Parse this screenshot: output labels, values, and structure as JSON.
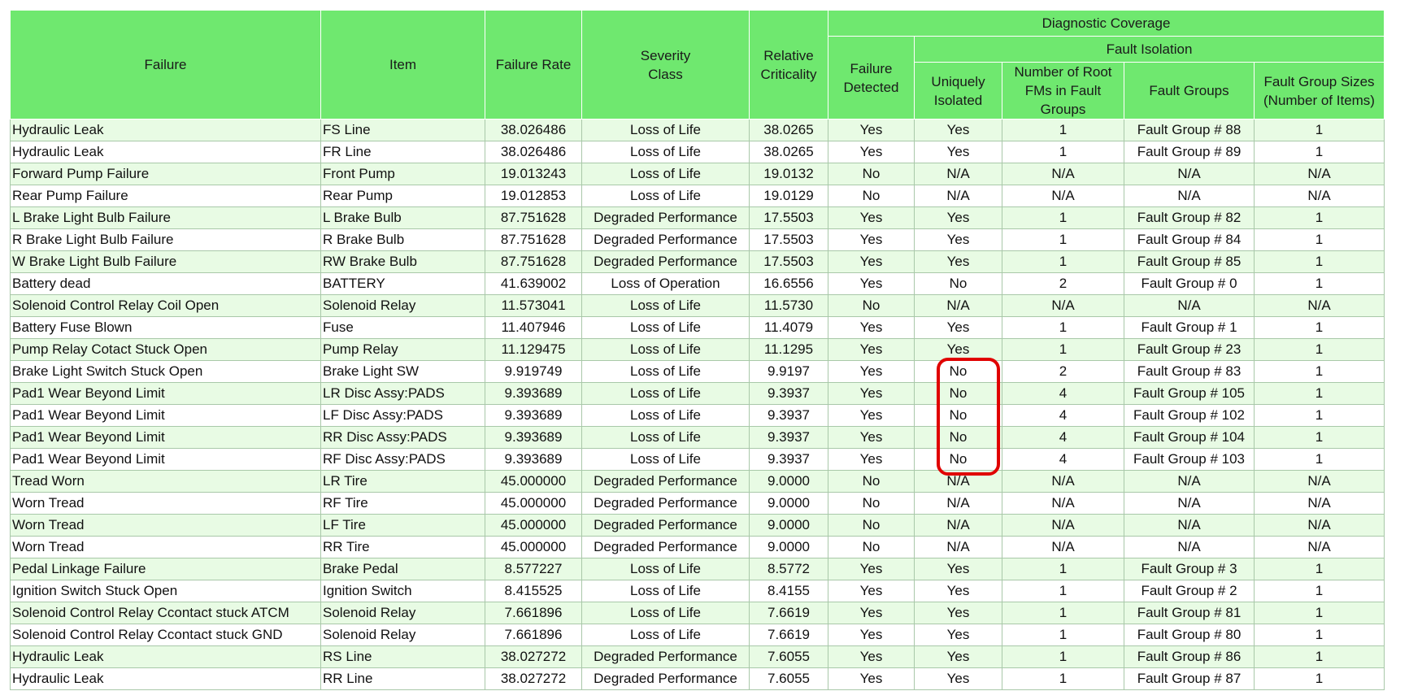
{
  "headers": {
    "failure": "Failure",
    "item": "Item",
    "failure_rate": "Failure Rate",
    "severity_class": "Severity Class",
    "relative_criticality": "Relative Criticality",
    "diagnostic_coverage": "Diagnostic Coverage",
    "failure_detected": "Failure Detected",
    "fault_isolation": "Fault Isolation",
    "uniquely_isolated": "Uniquely Isolated",
    "num_root_fms": "Number of Root FMs in Fault Groups",
    "fault_groups": "Fault Groups",
    "fault_group_sizes": "Fault Group Sizes (Number of Items)"
  },
  "highlight_color": "#e00000",
  "header_color": "#6fe86f",
  "stripe_color": "#e8fbe4",
  "rows": [
    [
      "Hydraulic Leak",
      "FS Line",
      "38.026486",
      "Loss of Life",
      "38.0265",
      "Yes",
      "Yes",
      "1",
      "Fault Group # 88",
      "1"
    ],
    [
      "Hydraulic Leak",
      "FR Line",
      "38.026486",
      "Loss of Life",
      "38.0265",
      "Yes",
      "Yes",
      "1",
      "Fault Group # 89",
      "1"
    ],
    [
      "Forward Pump Failure",
      "Front Pump",
      "19.013243",
      "Loss of Life",
      "19.0132",
      "No",
      "N/A",
      "N/A",
      "N/A",
      "N/A"
    ],
    [
      "Rear Pump Failure",
      "Rear Pump",
      "19.012853",
      "Loss of Life",
      "19.0129",
      "No",
      "N/A",
      "N/A",
      "N/A",
      "N/A"
    ],
    [
      "L Brake Light Bulb Failure",
      "L Brake Bulb",
      "87.751628",
      "Degraded Performance",
      "17.5503",
      "Yes",
      "Yes",
      "1",
      "Fault Group # 82",
      "1"
    ],
    [
      "R Brake Light Bulb Failure",
      "R Brake Bulb",
      "87.751628",
      "Degraded Performance",
      "17.5503",
      "Yes",
      "Yes",
      "1",
      "Fault Group # 84",
      "1"
    ],
    [
      "W Brake Light Bulb Failure",
      "RW Brake Bulb",
      "87.751628",
      "Degraded Performance",
      "17.5503",
      "Yes",
      "Yes",
      "1",
      "Fault Group # 85",
      "1"
    ],
    [
      "Battery dead",
      "BATTERY",
      "41.639002",
      "Loss of Operation",
      "16.6556",
      "Yes",
      "No",
      "2",
      "Fault Group # 0",
      "1"
    ],
    [
      "Solenoid Control Relay Coil Open",
      "Solenoid Relay",
      "11.573041",
      "Loss of Life",
      "11.5730",
      "No",
      "N/A",
      "N/A",
      "N/A",
      "N/A"
    ],
    [
      "Battery Fuse Blown",
      "Fuse",
      "11.407946",
      "Loss of Life",
      "11.4079",
      "Yes",
      "Yes",
      "1",
      "Fault Group # 1",
      "1"
    ],
    [
      "Pump Relay Cotact Stuck Open",
      "Pump Relay",
      "11.129475",
      "Loss of Life",
      "11.1295",
      "Yes",
      "Yes",
      "1",
      "Fault Group # 23",
      "1"
    ],
    [
      "Brake Light Switch Stuck Open",
      "Brake Light SW",
      "9.919749",
      "Loss of Life",
      "9.9197",
      "Yes",
      "No",
      "2",
      "Fault Group # 83",
      "1"
    ],
    [
      "Pad1 Wear Beyond Limit",
      "LR Disc Assy:PADS",
      "9.393689",
      "Loss of Life",
      "9.3937",
      "Yes",
      "No",
      "4",
      "Fault Group # 105",
      "1"
    ],
    [
      "Pad1 Wear Beyond Limit",
      "LF Disc Assy:PADS",
      "9.393689",
      "Loss of Life",
      "9.3937",
      "Yes",
      "No",
      "4",
      "Fault Group # 102",
      "1"
    ],
    [
      "Pad1 Wear Beyond Limit",
      "RR Disc Assy:PADS",
      "9.393689",
      "Loss of Life",
      "9.3937",
      "Yes",
      "No",
      "4",
      "Fault Group # 104",
      "1"
    ],
    [
      "Pad1 Wear Beyond Limit",
      "RF Disc Assy:PADS",
      "9.393689",
      "Loss of Life",
      "9.3937",
      "Yes",
      "No",
      "4",
      "Fault Group # 103",
      "1"
    ],
    [
      "Tread Worn",
      "LR Tire",
      "45.000000",
      "Degraded Performance",
      "9.0000",
      "No",
      "N/A",
      "N/A",
      "N/A",
      "N/A"
    ],
    [
      "Worn Tread",
      "RF Tire",
      "45.000000",
      "Degraded Performance",
      "9.0000",
      "No",
      "N/A",
      "N/A",
      "N/A",
      "N/A"
    ],
    [
      "Worn Tread",
      "LF Tire",
      "45.000000",
      "Degraded Performance",
      "9.0000",
      "No",
      "N/A",
      "N/A",
      "N/A",
      "N/A"
    ],
    [
      "Worn Tread",
      "RR Tire",
      "45.000000",
      "Degraded Performance",
      "9.0000",
      "No",
      "N/A",
      "N/A",
      "N/A",
      "N/A"
    ],
    [
      "Pedal Linkage Failure",
      "Brake Pedal",
      "8.577227",
      "Loss of Life",
      "8.5772",
      "Yes",
      "Yes",
      "1",
      "Fault Group # 3",
      "1"
    ],
    [
      "Ignition Switch Stuck Open",
      "Ignition Switch",
      "8.415525",
      "Loss of Life",
      "8.4155",
      "Yes",
      "Yes",
      "1",
      "Fault Group # 2",
      "1"
    ],
    [
      "Solenoid Control Relay Ccontact stuck ATCM",
      "Solenoid Relay",
      "7.661896",
      "Loss of Life",
      "7.6619",
      "Yes",
      "Yes",
      "1",
      "Fault Group # 81",
      "1"
    ],
    [
      "Solenoid Control Relay Ccontact stuck GND",
      "Solenoid Relay",
      "7.661896",
      "Loss of Life",
      "7.6619",
      "Yes",
      "Yes",
      "1",
      "Fault Group # 80",
      "1"
    ],
    [
      "Hydraulic Leak",
      "RS Line",
      "38.027272",
      "Degraded Performance",
      "7.6055",
      "Yes",
      "Yes",
      "1",
      "Fault Group # 86",
      "1"
    ],
    [
      "Hydraulic Leak",
      "RR Line",
      "38.027272",
      "Degraded Performance",
      "7.6055",
      "Yes",
      "Yes",
      "1",
      "Fault Group # 87",
      "1"
    ]
  ]
}
